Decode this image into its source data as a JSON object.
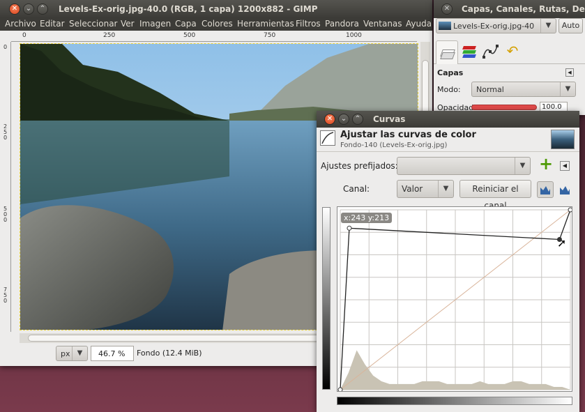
{
  "image_window": {
    "title": "Levels-Ex-orig.jpg-40.0 (RGB, 1 capa) 1200x882 - GIMP",
    "menu": [
      "Archivo",
      "Editar",
      "Seleccionar",
      "Ver",
      "Imagen",
      "Capa",
      "Colores",
      "Herramientas",
      "Filtros",
      "Pandora",
      "Ventanas",
      "Ayuda"
    ],
    "ruler_labels": [
      "0",
      "250",
      "500",
      "750",
      "1000"
    ],
    "vruler_labels": [
      "0",
      "2\n5\n0",
      "5\n0\n0",
      "7\n5\n0"
    ],
    "unit": "px",
    "zoom": "46.7 %",
    "status": "Fondo (12.4 MiB)"
  },
  "layers_dock": {
    "title": "Capas, Canales, Rutas, De",
    "image_name": "Levels-Ex-orig.jpg-40",
    "auto_label": "Auto",
    "tab_icons": [
      "layers-icon",
      "channels-icon",
      "paths-icon",
      "undo-icon"
    ],
    "section_title": "Capas",
    "mode_label": "Modo:",
    "mode_value": "Normal",
    "opacity_label": "Opacidad:",
    "opacity_value": "100.0"
  },
  "curves_dialog": {
    "title": "Curvas",
    "heading": "Ajustar las curvas de color",
    "subheading": "Fondo-140 (Levels-Ex-orig.jpg)",
    "presets_label": "Ajustes prefijados:",
    "channel_label": "Canal:",
    "channel_value": "Valor",
    "reset_label": "Reiniciar el canal",
    "cursor_readout": "x:243 y:213",
    "curve_points": [
      [
        0,
        0
      ],
      [
        10,
        229
      ],
      [
        243,
        213
      ],
      [
        255,
        255
      ]
    ]
  },
  "colors": {
    "title_bar": "#3c3b37",
    "close_button": "#e0522a",
    "dialog_bg": "#edeceb",
    "plus_green": "#4e9a06"
  }
}
